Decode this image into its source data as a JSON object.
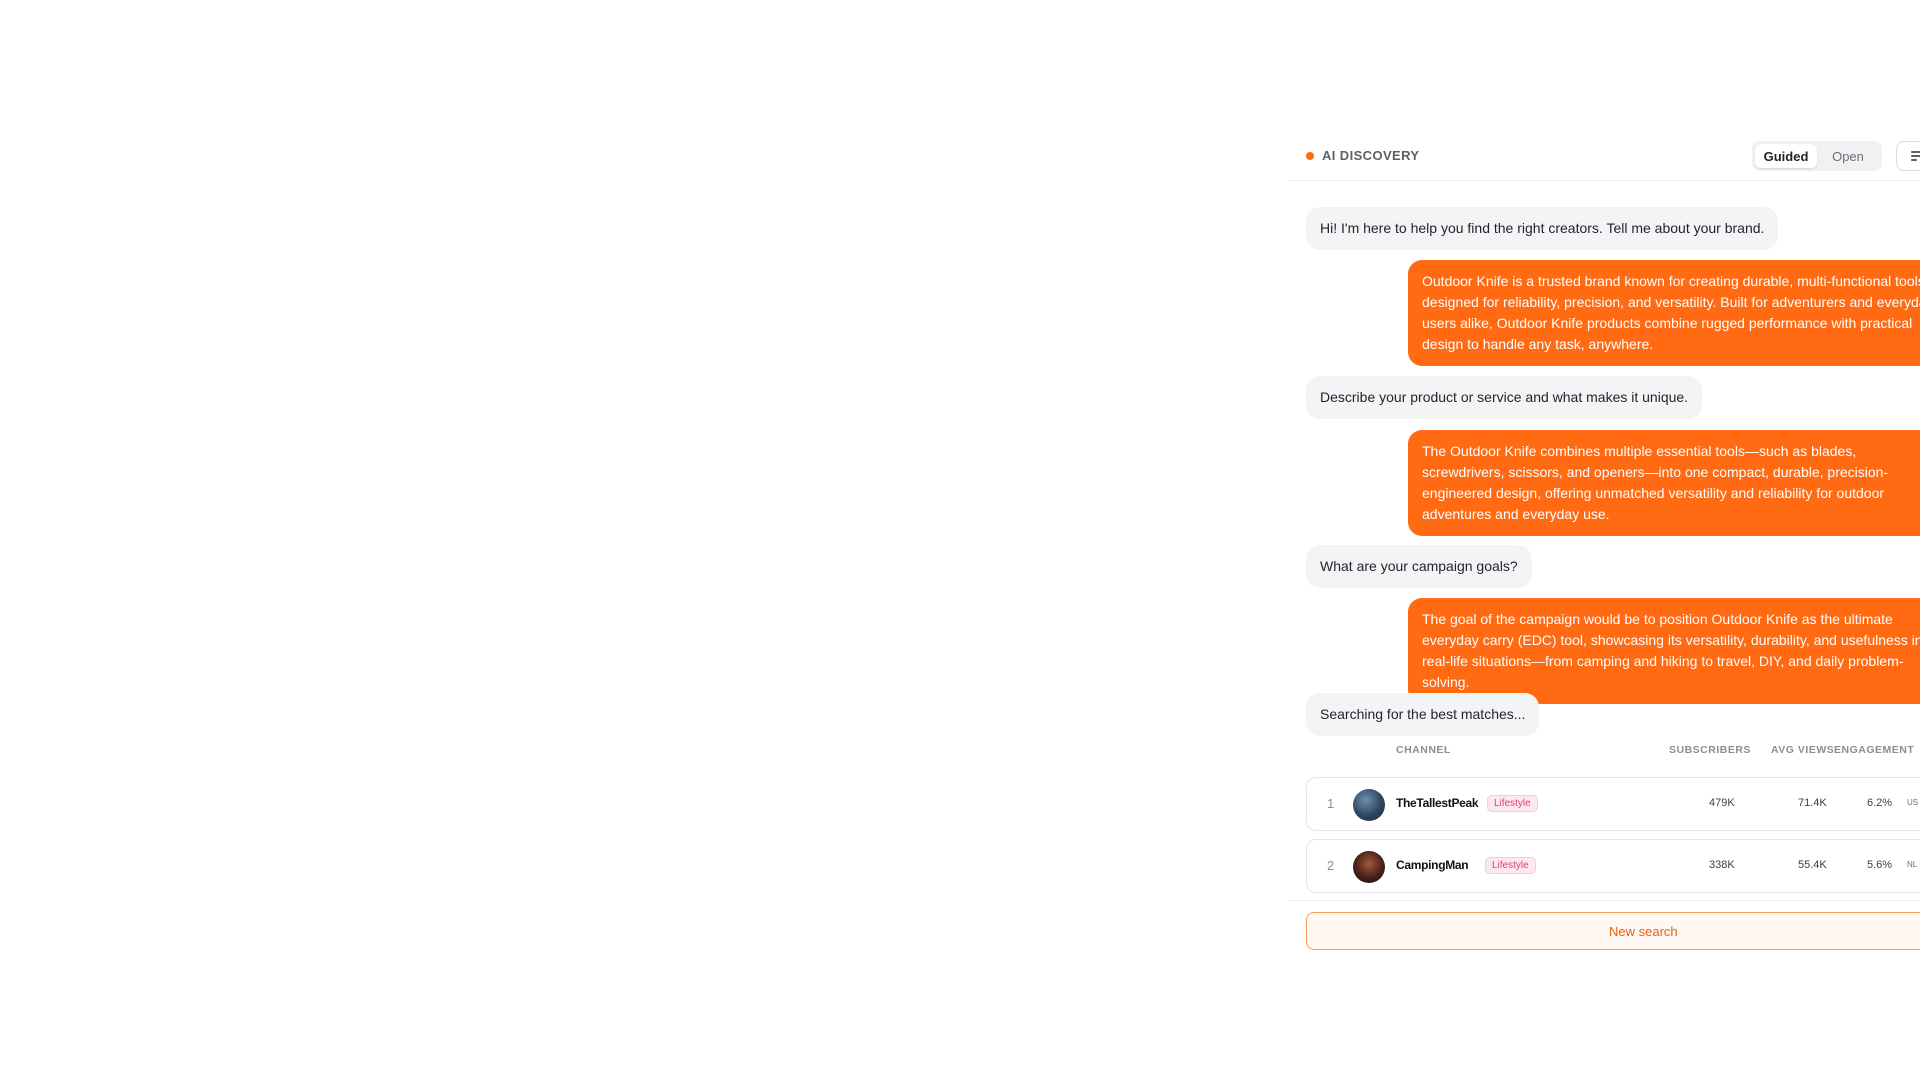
{
  "header": {
    "brand_label": "AI DISCOVERY",
    "modes": [
      "Guided",
      "Open"
    ],
    "active_mode": "Guided"
  },
  "chat": {
    "messages": [
      {
        "role": "assistant",
        "text": "Hi! I'm here to help you find the right creators. Tell me about your brand."
      },
      {
        "role": "user",
        "text": "Outdoor Knife is a trusted brand known for creating durable, multi-functional tools designed for reliability, precision, and versatility. Built for adventurers and everyday users alike, Outdoor Knife products combine rugged performance with practical design to handle any task, anywhere."
      },
      {
        "role": "assistant",
        "text": "Describe your product or service and what makes it unique."
      },
      {
        "role": "user",
        "text": "The Outdoor Knife combines multiple essential tools—such as blades, screwdrivers, scissors, and openers—into one compact, durable, precision-engineered design, offering unmatched versatility and reliability for outdoor adventures and everyday use."
      },
      {
        "role": "assistant",
        "text": "What are your campaign goals?"
      },
      {
        "role": "user",
        "text": "The goal of the campaign would be to position Outdoor Knife as the ultimate everyday carry (EDC) tool, showcasing its versatility, durability, and usefulness in real-life situations—from camping and hiking to travel, DIY, and daily problem-solving."
      },
      {
        "role": "assistant",
        "text": "Searching for the best matches..."
      }
    ]
  },
  "results": {
    "columns": {
      "channel": "CHANNEL",
      "subscribers": "SUBSCRIBERS",
      "avg_views": "AVG VIEWS",
      "engagement": "ENGAGEMENT"
    },
    "rows": [
      {
        "rank": "1",
        "name": "TheTallestPeak",
        "category": "Lifestyle",
        "subscribers": "479K",
        "avg_views": "71.4K",
        "engagement": "6.2%",
        "country": "US"
      },
      {
        "rank": "2",
        "name": "CampingMan",
        "category": "Lifestyle",
        "subscribers": "338K",
        "avg_views": "55.4K",
        "engagement": "5.6%",
        "country": "NL"
      }
    ]
  },
  "actions": {
    "new_search_label": "New search"
  },
  "icons": {
    "filter": "filter-icon",
    "brand_dot": "status-dot-icon"
  },
  "colors": {
    "accent": "#ff6a13",
    "bot_bubble": "#f3f4f6",
    "tag_text": "#d6457a",
    "tag_bg": "#fde8ef"
  }
}
